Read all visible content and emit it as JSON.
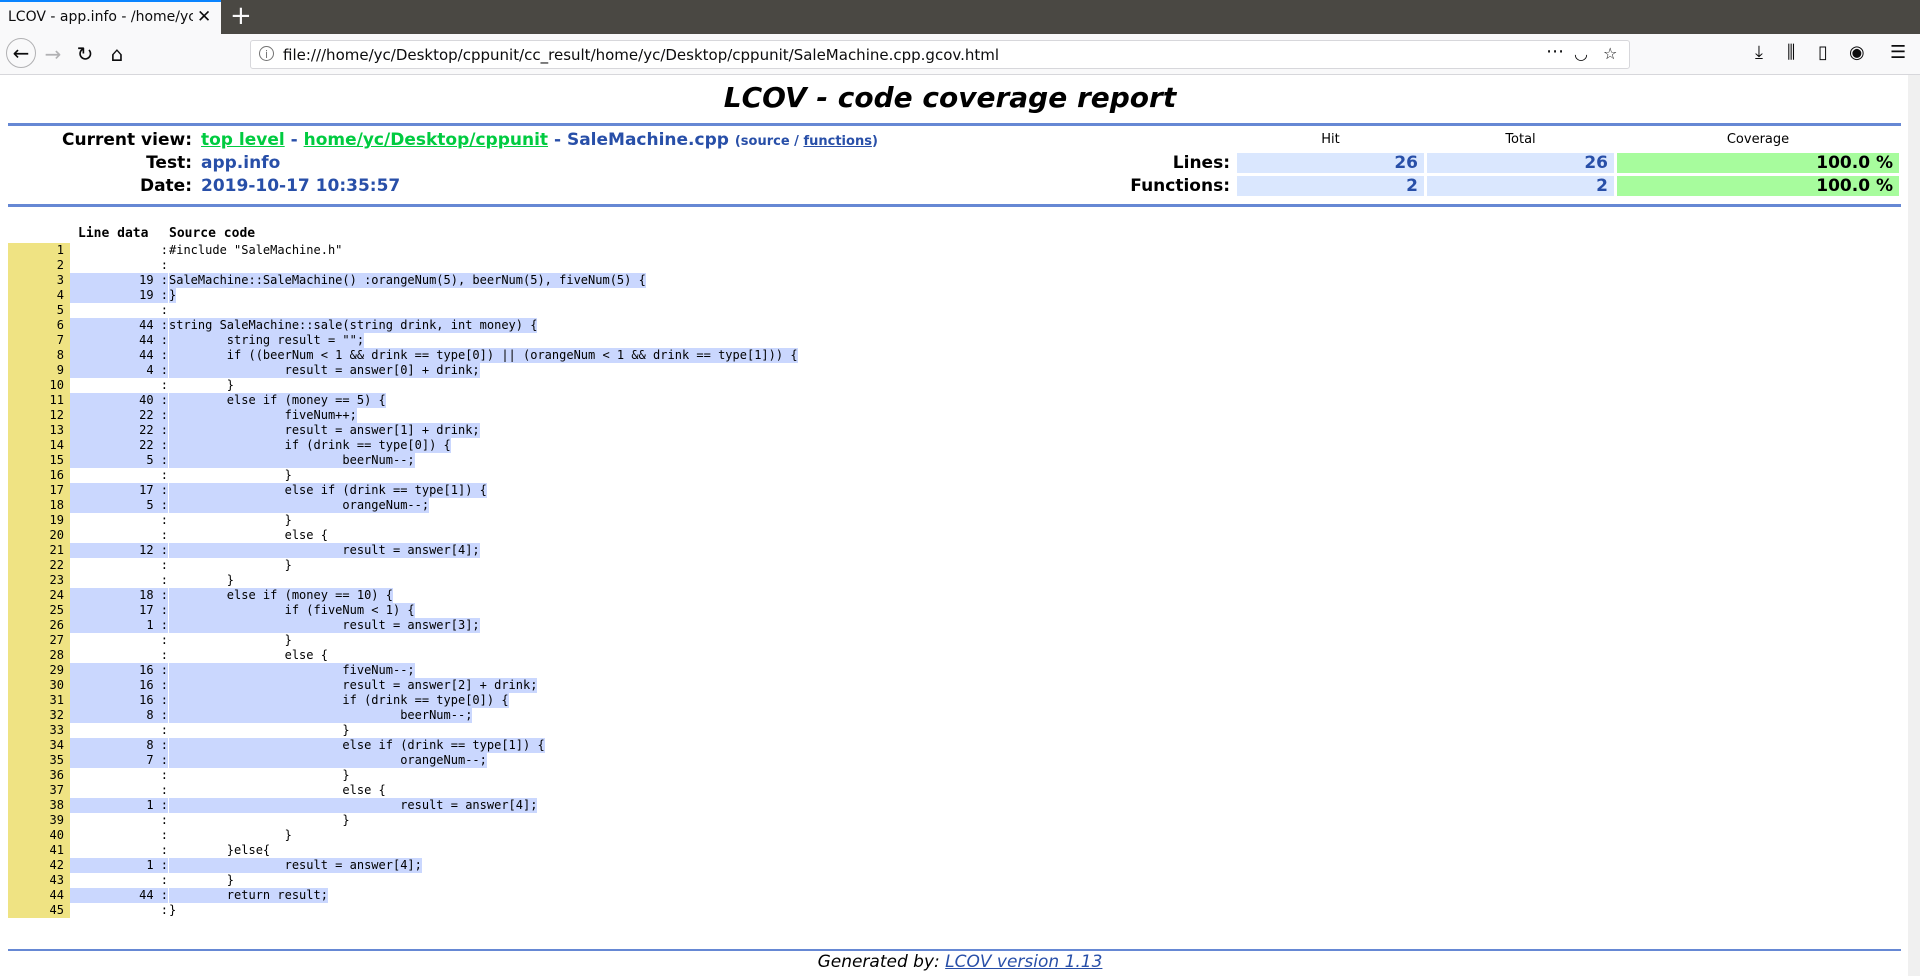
{
  "browser": {
    "tab_title": "LCOV - app.info - /home/yc/",
    "url": "file:///home/yc/Desktop/cppunit/cc_result/home/yc/Desktop/cppunit/SaleMachine.cpp.gcov.html",
    "icons": [
      "back-icon",
      "forward-icon",
      "reload-icon",
      "home-icon",
      "info-icon",
      "more-icon",
      "pocket-icon",
      "star-icon",
      "download-icon",
      "library-icon",
      "sidebar-icon",
      "account-icon",
      "menu-icon"
    ]
  },
  "report": {
    "title": "LCOV - code coverage report",
    "current_view_label": "Current view:",
    "top_level": "top level",
    "sep1": " - ",
    "dir": "home/yc/Desktop/cppunit",
    "sep2": " - ",
    "file": "SaleMachine.cpp",
    "source_paren_open": "(source / ",
    "functions_link": "functions",
    "source_paren_close": ")",
    "test_label": "Test:",
    "test_value": "app.info",
    "date_label": "Date:",
    "date_value": "2019-10-17 10:35:57",
    "hit_header": "Hit",
    "total_header": "Total",
    "coverage_header": "Coverage",
    "lines_label": "Lines:",
    "lines_hit": "26",
    "lines_total": "26",
    "lines_cov": "100.0 %",
    "functions_label": "Functions:",
    "functions_hit": "2",
    "functions_total": "2",
    "functions_cov": "100.0 %",
    "col_line_data": "Line data",
    "col_source_code": "Source code",
    "footer_prefix": "Generated by: ",
    "footer_link": "LCOV version 1.13"
  },
  "source_rows": [
    {
      "n": "1",
      "c": "",
      "t": "#include \"SaleMachine.h\""
    },
    {
      "n": "2",
      "c": "",
      "t": ""
    },
    {
      "n": "3",
      "c": "19",
      "t": "SaleMachine::SaleMachine() :orangeNum(5), beerNum(5), fiveNum(5) {"
    },
    {
      "n": "4",
      "c": "19",
      "t": "}"
    },
    {
      "n": "5",
      "c": "",
      "t": ""
    },
    {
      "n": "6",
      "c": "44",
      "t": "string SaleMachine::sale(string drink, int money) {"
    },
    {
      "n": "7",
      "c": "44",
      "t": "        string result = \"\";"
    },
    {
      "n": "8",
      "c": "44",
      "t": "        if ((beerNum < 1 && drink == type[0]) || (orangeNum < 1 && drink == type[1])) {"
    },
    {
      "n": "9",
      "c": "4",
      "t": "                result = answer[0] + drink;"
    },
    {
      "n": "10",
      "c": "",
      "t": "        }"
    },
    {
      "n": "11",
      "c": "40",
      "t": "        else if (money == 5) {"
    },
    {
      "n": "12",
      "c": "22",
      "t": "                fiveNum++;"
    },
    {
      "n": "13",
      "c": "22",
      "t": "                result = answer[1] + drink;"
    },
    {
      "n": "14",
      "c": "22",
      "t": "                if (drink == type[0]) {"
    },
    {
      "n": "15",
      "c": "5",
      "t": "                        beerNum--;"
    },
    {
      "n": "16",
      "c": "",
      "t": "                }"
    },
    {
      "n": "17",
      "c": "17",
      "t": "                else if (drink == type[1]) {"
    },
    {
      "n": "18",
      "c": "5",
      "t": "                        orangeNum--;"
    },
    {
      "n": "19",
      "c": "",
      "t": "                }"
    },
    {
      "n": "20",
      "c": "",
      "t": "                else {"
    },
    {
      "n": "21",
      "c": "12",
      "t": "                        result = answer[4];"
    },
    {
      "n": "22",
      "c": "",
      "t": "                }"
    },
    {
      "n": "23",
      "c": "",
      "t": "        }"
    },
    {
      "n": "24",
      "c": "18",
      "t": "        else if (money == 10) {"
    },
    {
      "n": "25",
      "c": "17",
      "t": "                if (fiveNum < 1) {"
    },
    {
      "n": "26",
      "c": "1",
      "t": "                        result = answer[3];"
    },
    {
      "n": "27",
      "c": "",
      "t": "                }"
    },
    {
      "n": "28",
      "c": "",
      "t": "                else {"
    },
    {
      "n": "29",
      "c": "16",
      "t": "                        fiveNum--;"
    },
    {
      "n": "30",
      "c": "16",
      "t": "                        result = answer[2] + drink;"
    },
    {
      "n": "31",
      "c": "16",
      "t": "                        if (drink == type[0]) {"
    },
    {
      "n": "32",
      "c": "8",
      "t": "                                beerNum--;"
    },
    {
      "n": "33",
      "c": "",
      "t": "                        }"
    },
    {
      "n": "34",
      "c": "8",
      "t": "                        else if (drink == type[1]) {"
    },
    {
      "n": "35",
      "c": "7",
      "t": "                                orangeNum--;"
    },
    {
      "n": "36",
      "c": "",
      "t": "                        }"
    },
    {
      "n": "37",
      "c": "",
      "t": "                        else {"
    },
    {
      "n": "38",
      "c": "1",
      "t": "                                result = answer[4];"
    },
    {
      "n": "39",
      "c": "",
      "t": "                        }"
    },
    {
      "n": "40",
      "c": "",
      "t": "                }"
    },
    {
      "n": "41",
      "c": "",
      "t": "        }else{"
    },
    {
      "n": "42",
      "c": "1",
      "t": "                result = answer[4];"
    },
    {
      "n": "43",
      "c": "",
      "t": "        }"
    },
    {
      "n": "44",
      "c": "44",
      "t": "        return result;"
    },
    {
      "n": "45",
      "c": "",
      "t": "}"
    }
  ]
}
